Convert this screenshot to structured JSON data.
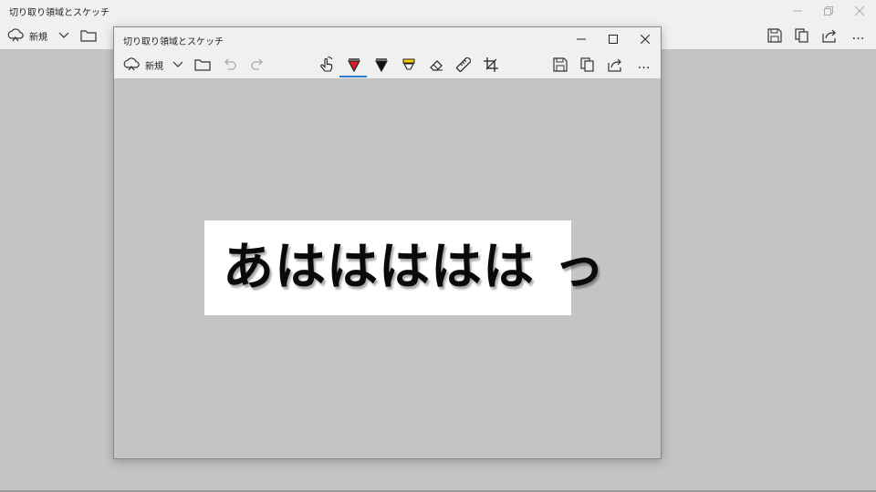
{
  "app": {
    "title": "切り取り領域とスケッチ"
  },
  "outer_window": {
    "title": "切り取り領域とスケッチ",
    "toolbar": {
      "new_label": "新規",
      "more_label": "…"
    }
  },
  "inner_window": {
    "title": "切り取り領域とスケッチ",
    "toolbar": {
      "new_label": "新規",
      "more_label": "…",
      "selected_tool": "ballpoint-pen"
    },
    "icons": [
      "new-snip-icon",
      "chevron-down-icon",
      "folder-icon",
      "undo-icon",
      "redo-icon",
      "touch-writing-icon",
      "ballpoint-pen-icon",
      "pencil-icon",
      "highlighter-icon",
      "eraser-icon",
      "ruler-icon",
      "crop-icon",
      "save-icon",
      "copy-icon",
      "share-icon"
    ]
  },
  "canvas": {
    "snip_text": "あははははは っ"
  },
  "colors": {
    "accent": "#2b7cd3",
    "pen_red": "#d81e1e",
    "highlighter_yellow": "#f5d400",
    "canvas_bg": "#c4c4c4",
    "chrome": "#f0f0f0"
  }
}
